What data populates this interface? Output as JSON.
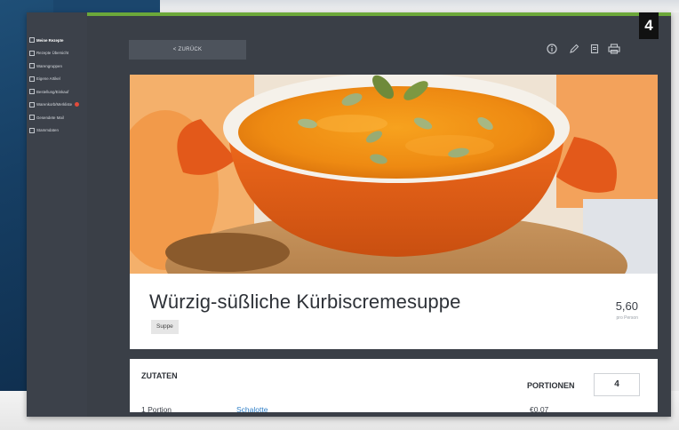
{
  "back_button": {
    "label": "< ZURÜCK"
  },
  "step_badge": "4",
  "sidebar": {
    "items": [
      {
        "label": "Meine Rezepte"
      },
      {
        "label": "Rezepte Übersicht"
      },
      {
        "label": "Warengruppen"
      },
      {
        "label": "Eigene Artikel"
      },
      {
        "label": "Bestellung/Einkauf"
      },
      {
        "label": "Warenkorb/Merkliste"
      },
      {
        "label": "Gesendete Mail"
      },
      {
        "label": "Stammdaten"
      }
    ]
  },
  "toolbar": {
    "icons": [
      "info-icon",
      "edit-icon",
      "print-list-icon",
      "printer-icon"
    ]
  },
  "recipe": {
    "title": "Würzig-süßliche Kürbiscremesuppe",
    "tag": "Suppe",
    "price": "5,60",
    "price_unit": "pro Person"
  },
  "ingredients": {
    "heading": "ZUTATEN",
    "portions_label": "PORTIONEN",
    "portions_value": "4",
    "rows": [
      {
        "qty": "1 Portion",
        "name": "Schalotte",
        "cost": "€0,07"
      }
    ]
  },
  "colors": {
    "accent": "#6ca83a",
    "sidebar_bg": "#3c414a",
    "main_bg": "#3a3f47",
    "link": "#2f7fc7",
    "notification": "#e24b3b"
  }
}
